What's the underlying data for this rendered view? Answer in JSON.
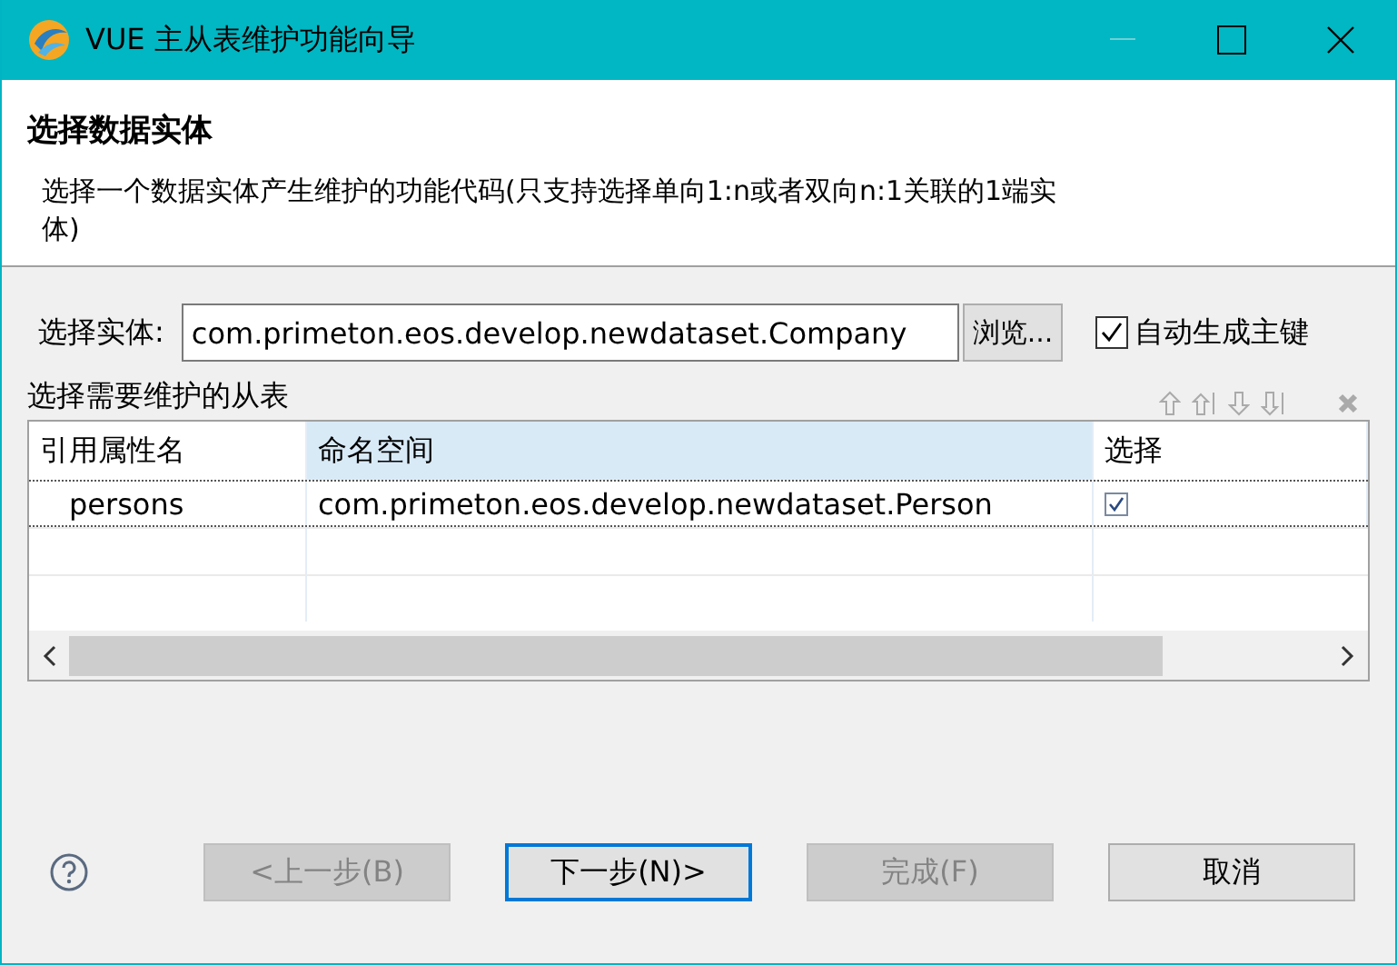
{
  "window": {
    "title": "VUE 主从表维护功能向导",
    "minimize_disabled": true
  },
  "header": {
    "title": "选择数据实体",
    "description": "选择一个数据实体产生维护的功能代码(只支持选择单向1:n或者双向n:1关联的1端实体)"
  },
  "entity": {
    "label": "选择实体:",
    "value": "com.primeton.eos.develop.newdataset.Company",
    "browse": "浏览...",
    "auto_key": {
      "label": "自动生成主键",
      "checked": true
    }
  },
  "table": {
    "label": "选择需要维护的从表",
    "columns": [
      {
        "label": "引用属性名",
        "selected": false
      },
      {
        "label": "命名空间",
        "selected": true
      },
      {
        "label": "选择",
        "selected": false
      }
    ],
    "rows": [
      {
        "name": "persons",
        "namespace": "com.primeton.eos.develop.newdataset.Person",
        "checked": true
      }
    ]
  },
  "buttons": [
    {
      "label": "<上一步(B)",
      "disabled": true,
      "default": false
    },
    {
      "label": "下一步(N)>",
      "disabled": false,
      "default": true
    },
    {
      "label": "完成(F)",
      "disabled": true,
      "default": false
    },
    {
      "label": "取消",
      "disabled": false,
      "default": false
    }
  ]
}
